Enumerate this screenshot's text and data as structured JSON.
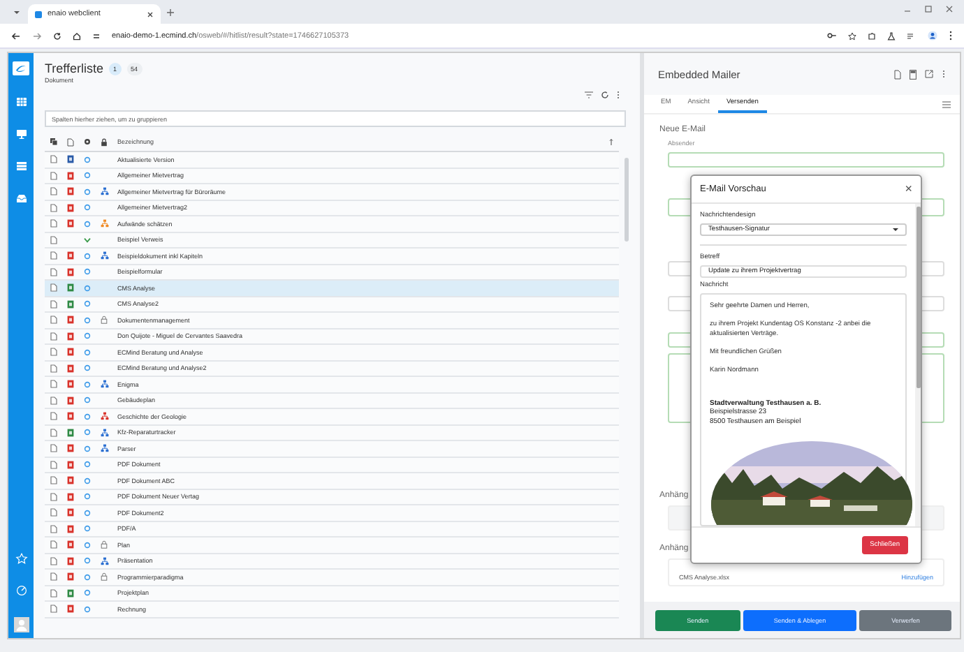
{
  "browser": {
    "tab_title": "enaio webclient",
    "url_host": "enaio-demo-1.ecmind.ch",
    "url_path": "/osweb/#/hitlist/result?state=1746627105373"
  },
  "hitlist": {
    "title": "Trefferliste",
    "badges": [
      {
        "label": "1",
        "selected": true
      },
      {
        "label": "54",
        "selected": false
      }
    ],
    "subtitle": "Dokument",
    "group_placeholder": "Spalten hierher ziehen, um zu gruppieren",
    "column": "Bezeichnung",
    "rows": [
      {
        "name": "Aktualisierte Version",
        "kind": "word",
        "locked": false,
        "selected": false
      },
      {
        "name": "Allgemeiner Mietvertrag",
        "kind": "pdf",
        "locked": false,
        "selected": false
      },
      {
        "name": "Allgemeiner Mietvertrag für Büroräume",
        "kind": "pdf",
        "color": "#2b6fd1",
        "locked": false,
        "selected": false
      },
      {
        "name": "Allgemeiner Mietvertrag2",
        "kind": "pdf",
        "locked": false,
        "selected": false
      },
      {
        "name": "Aufwände schätzen",
        "kind": "pdf",
        "color": "#f08a24",
        "locked": false,
        "selected": false
      },
      {
        "name": "Beispiel Verweis",
        "kind": "link",
        "locked": false,
        "selected": false
      },
      {
        "name": "Beispieldokument inkl Kapiteln",
        "kind": "pdf",
        "color": "#2b6fd1",
        "locked": false,
        "selected": false
      },
      {
        "name": "Beispielformular",
        "kind": "pdf",
        "locked": false,
        "selected": false
      },
      {
        "name": "CMS Analyse",
        "kind": "excel",
        "locked": false,
        "selected": true
      },
      {
        "name": "CMS Analyse2",
        "kind": "excel",
        "locked": false,
        "selected": false
      },
      {
        "name": "Dokumentenmanagement",
        "kind": "pdf",
        "locked": true,
        "selected": false
      },
      {
        "name": "Don Quijote - Miguel de Cervantes Saavedra",
        "kind": "pdf",
        "locked": false,
        "selected": false
      },
      {
        "name": "ECMind Beratung und Analyse",
        "kind": "pdf",
        "locked": false,
        "selected": false
      },
      {
        "name": "ECMind Beratung und Analyse2",
        "kind": "pdf",
        "locked": false,
        "selected": false
      },
      {
        "name": "Enigma",
        "kind": "pdf",
        "color": "#2b6fd1",
        "locked": false,
        "selected": false
      },
      {
        "name": "Gebäudeplan",
        "kind": "pdf",
        "locked": false,
        "selected": false
      },
      {
        "name": "Geschichte der Geologie",
        "kind": "pdf",
        "color": "#d9332b",
        "locked": false,
        "selected": false
      },
      {
        "name": "Kfz-Reparaturtracker",
        "kind": "excel",
        "color": "#2b6fd1",
        "locked": false,
        "selected": false
      },
      {
        "name": "Parser",
        "kind": "pdf",
        "color": "#2b6fd1",
        "locked": false,
        "selected": false
      },
      {
        "name": "PDF Dokument",
        "kind": "pdf",
        "locked": false,
        "selected": false
      },
      {
        "name": "PDF Dokument ABC",
        "kind": "pdf",
        "locked": false,
        "selected": false
      },
      {
        "name": "PDF Dokument Neuer Vertag",
        "kind": "pdf",
        "locked": false,
        "selected": false
      },
      {
        "name": "PDF Dokument2",
        "kind": "pdf",
        "locked": false,
        "selected": false
      },
      {
        "name": "PDF/A",
        "kind": "pdf",
        "locked": false,
        "selected": false
      },
      {
        "name": "Plan",
        "kind": "pdf",
        "locked": true,
        "selected": false
      },
      {
        "name": "Präsentation",
        "kind": "pdf",
        "color": "#2b6fd1",
        "locked": false,
        "selected": false
      },
      {
        "name": "Programmierparadigma",
        "kind": "pdf",
        "locked": true,
        "selected": false
      },
      {
        "name": "Projektplan",
        "kind": "excel",
        "locked": false,
        "selected": false
      },
      {
        "name": "Rechnung",
        "kind": "pdf",
        "locked": false,
        "selected": false
      }
    ]
  },
  "mailer": {
    "title": "Embedded Mailer",
    "tabs": [
      {
        "label": "EM",
        "selected": false
      },
      {
        "label": "Ansicht",
        "selected": false
      },
      {
        "label": "Versenden",
        "selected": true
      }
    ],
    "section_title": "Neue E-Mail",
    "sender_label": "Absender",
    "attachments": [
      {
        "label": "Anhäng"
      },
      {
        "label": "Anhäng",
        "file": "CMS Analyse.xlsx",
        "action": "Hinzufügen"
      }
    ],
    "actions": [
      {
        "label": "Senden",
        "kind": "success"
      },
      {
        "label": "Senden & Ablegen",
        "kind": "primary"
      },
      {
        "label": "Verwerfen",
        "kind": "secondary"
      }
    ]
  },
  "dialog": {
    "title": "E-Mail Vorschau",
    "close": "×",
    "design_label": "Nachrichtendesign",
    "design_value": "Testhausen-Signatur",
    "subject_label": "Betreff",
    "subject_value": "Update zu ihrem Projektvertrag",
    "message_label": "Nachricht",
    "message_paragraphs": [
      "Sehr geehrte Damen und Herren,",
      "zu ihrem Projekt Kundentag OS Konstanz -2 anbei die aktualisierten Verträge.",
      "Mit freundlichen Grüßen",
      "Karin Nordmann"
    ],
    "signature": {
      "org": "Stadtverwaltung Testhausen a. B.",
      "street": "Beispielstrasse 23",
      "city": "8500 Testhausen am Beispiel"
    },
    "close_button": "Schließen"
  }
}
